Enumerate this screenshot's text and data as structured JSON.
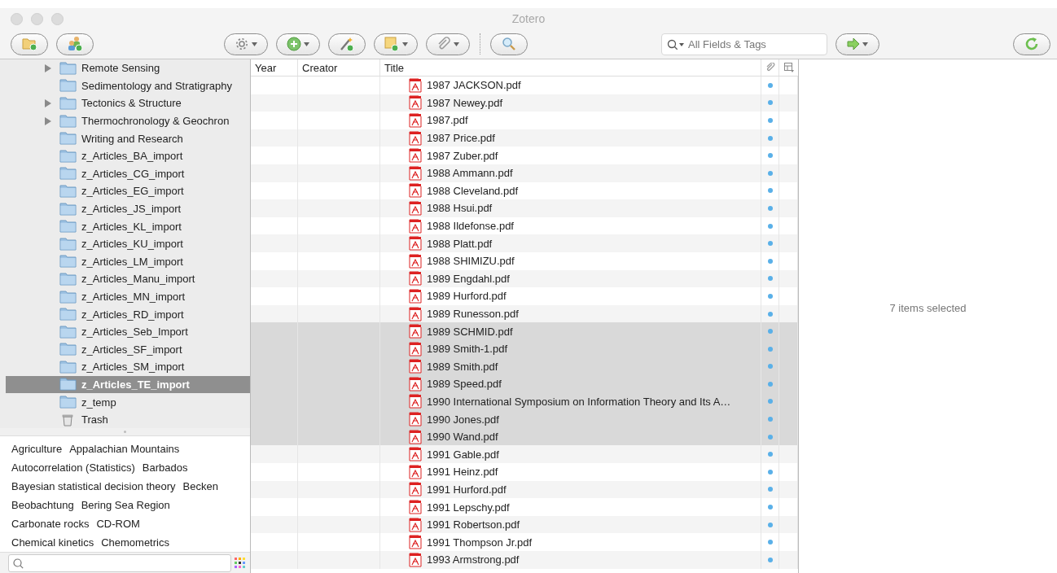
{
  "window": {
    "title": "Zotero"
  },
  "search": {
    "placeholder": "All Fields & Tags"
  },
  "collections": [
    {
      "name": "Remote Sensing",
      "kind": "folder",
      "expandable": true,
      "selected": false
    },
    {
      "name": "Sedimentology and Stratigraphy",
      "kind": "folder",
      "expandable": false,
      "selected": false
    },
    {
      "name": "Tectonics & Structure",
      "kind": "folder",
      "expandable": true,
      "selected": false
    },
    {
      "name": "Thermochronology & Geochron",
      "kind": "folder",
      "expandable": true,
      "selected": false
    },
    {
      "name": "Writing and Research",
      "kind": "folder",
      "expandable": false,
      "selected": false
    },
    {
      "name": "z_Articles_BA_import",
      "kind": "folder",
      "expandable": false,
      "selected": false
    },
    {
      "name": "z_Articles_CG_import",
      "kind": "folder",
      "expandable": false,
      "selected": false
    },
    {
      "name": "z_Articles_EG_import",
      "kind": "folder",
      "expandable": false,
      "selected": false
    },
    {
      "name": "z_Articles_JS_import",
      "kind": "folder",
      "expandable": false,
      "selected": false
    },
    {
      "name": "z_Articles_KL_import",
      "kind": "folder",
      "expandable": false,
      "selected": false
    },
    {
      "name": "z_Articles_KU_import",
      "kind": "folder",
      "expandable": false,
      "selected": false
    },
    {
      "name": "z_Articles_LM_import",
      "kind": "folder",
      "expandable": false,
      "selected": false
    },
    {
      "name": "z_Articles_Manu_import",
      "kind": "folder",
      "expandable": false,
      "selected": false
    },
    {
      "name": "z_Articles_MN_import",
      "kind": "folder",
      "expandable": false,
      "selected": false
    },
    {
      "name": "z_Articles_RD_import",
      "kind": "folder",
      "expandable": false,
      "selected": false
    },
    {
      "name": "z_Articles_Seb_Import",
      "kind": "folder",
      "expandable": false,
      "selected": false
    },
    {
      "name": "z_Articles_SF_import",
      "kind": "folder",
      "expandable": false,
      "selected": false
    },
    {
      "name": "z_Articles_SM_import",
      "kind": "folder",
      "expandable": false,
      "selected": false
    },
    {
      "name": "z_Articles_TE_import",
      "kind": "folder",
      "expandable": false,
      "selected": true
    },
    {
      "name": "z_temp",
      "kind": "folder",
      "expandable": false,
      "selected": false
    },
    {
      "name": "Trash",
      "kind": "trash",
      "expandable": false,
      "selected": false
    }
  ],
  "tag_rows": [
    [
      "Agriculture",
      "Appalachian Mountains"
    ],
    [
      "Autocorrelation (Statistics)",
      "Barbados"
    ],
    [
      "Bayesian statistical decision theory",
      "Becken"
    ],
    [
      "Beobachtung",
      "Bering Sea Region"
    ],
    [
      "Carbonate rocks",
      "CD-ROM"
    ],
    [
      "Chemical kinetics",
      "Chemometrics"
    ]
  ],
  "table": {
    "columns": [
      "Year",
      "Creator",
      "Title"
    ],
    "rows": [
      {
        "title": "1987 JACKSON.pdf",
        "selected": false,
        "attachment": true
      },
      {
        "title": "1987 Newey.pdf",
        "selected": false,
        "attachment": true
      },
      {
        "title": "1987.pdf",
        "selected": false,
        "attachment": true
      },
      {
        "title": "1987 Price.pdf",
        "selected": false,
        "attachment": true
      },
      {
        "title": "1987 Zuber.pdf",
        "selected": false,
        "attachment": true
      },
      {
        "title": "1988 Ammann.pdf",
        "selected": false,
        "attachment": true
      },
      {
        "title": "1988 Cleveland.pdf",
        "selected": false,
        "attachment": true
      },
      {
        "title": "1988 Hsui.pdf",
        "selected": false,
        "attachment": true
      },
      {
        "title": "1988 Ildefonse.pdf",
        "selected": false,
        "attachment": true
      },
      {
        "title": "1988 Platt.pdf",
        "selected": false,
        "attachment": true
      },
      {
        "title": "1988 SHIMIZU.pdf",
        "selected": false,
        "attachment": true
      },
      {
        "title": "1989 Engdahl.pdf",
        "selected": false,
        "attachment": true
      },
      {
        "title": "1989 Hurford.pdf",
        "selected": false,
        "attachment": true
      },
      {
        "title": "1989 Runesson.pdf",
        "selected": false,
        "attachment": true
      },
      {
        "title": "1989 SCHMID.pdf",
        "selected": true,
        "attachment": true
      },
      {
        "title": "1989 Smith-1.pdf",
        "selected": true,
        "attachment": true
      },
      {
        "title": "1989 Smith.pdf",
        "selected": true,
        "attachment": true
      },
      {
        "title": "1989 Speed.pdf",
        "selected": true,
        "attachment": true
      },
      {
        "title": "1990 International Symposium on Information Theory and Its A…",
        "selected": true,
        "attachment": true
      },
      {
        "title": "1990 Jones.pdf",
        "selected": true,
        "attachment": true
      },
      {
        "title": "1990 Wand.pdf",
        "selected": true,
        "attachment": true
      },
      {
        "title": "1991 Gable.pdf",
        "selected": false,
        "attachment": true
      },
      {
        "title": "1991 Heinz.pdf",
        "selected": false,
        "attachment": true
      },
      {
        "title": "1991 Hurford.pdf",
        "selected": false,
        "attachment": true
      },
      {
        "title": "1991 Lepschy.pdf",
        "selected": false,
        "attachment": true
      },
      {
        "title": "1991 Robertson.pdf",
        "selected": false,
        "attachment": true
      },
      {
        "title": "1991 Thompson Jr.pdf",
        "selected": false,
        "attachment": true
      },
      {
        "title": "1993 Armstrong.pdf",
        "selected": false,
        "attachment": true
      }
    ]
  },
  "item_pane": {
    "message": "7 items selected"
  }
}
